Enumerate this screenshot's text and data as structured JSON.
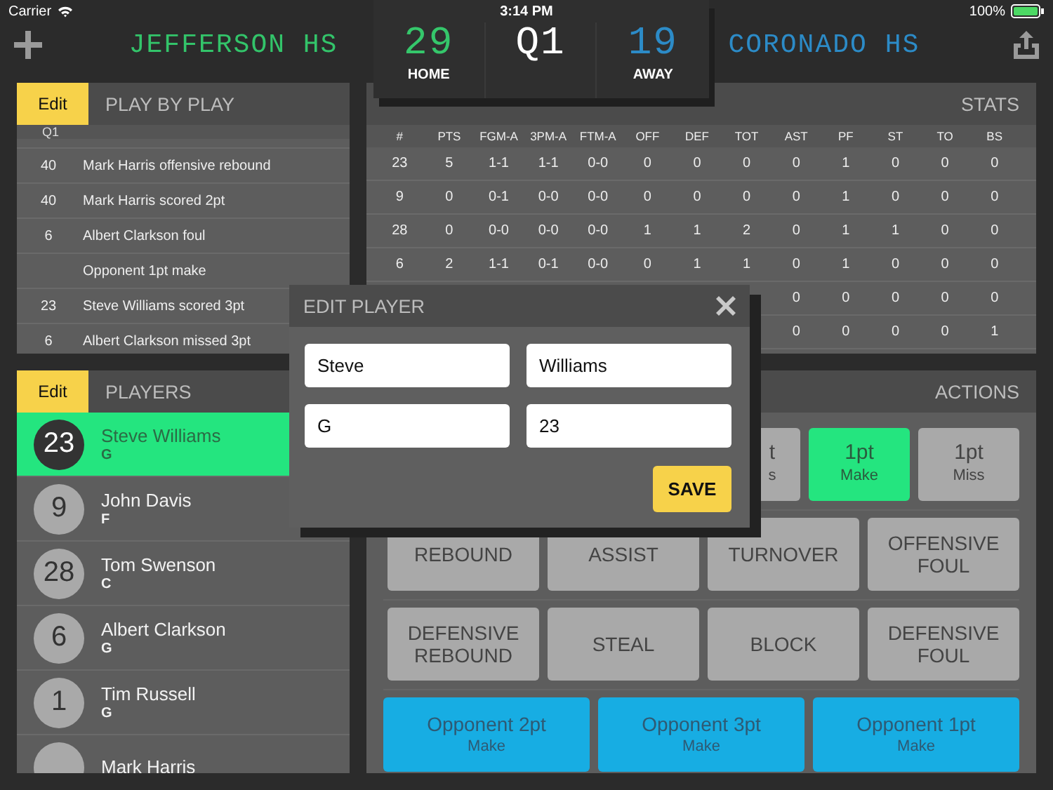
{
  "status_bar": {
    "carrier": "Carrier",
    "time": "3:14 PM",
    "battery": "100%"
  },
  "scoreboard": {
    "home_team": "JEFFERSON HS",
    "home_score": "29",
    "home_label": "HOME",
    "period": "Q1",
    "away_score": "19",
    "away_label": "AWAY",
    "away_team": "CORONADO HS"
  },
  "play_by_play": {
    "edit": "Edit",
    "title": "PLAY BY PLAY",
    "period": "Q1",
    "plays": [
      {
        "number": "40",
        "text": "Mark Harris offensive rebound"
      },
      {
        "number": "40",
        "text": "Mark Harris scored 2pt"
      },
      {
        "number": "6",
        "text": "Albert Clarkson foul"
      },
      {
        "text": "Opponent 1pt make"
      },
      {
        "number": "23",
        "text": "Steve Williams scored 3pt"
      },
      {
        "number": "6",
        "text": "Albert Clarkson missed 3pt"
      }
    ]
  },
  "stats": {
    "title": "STATS",
    "columns": [
      "#",
      "PTS",
      "FGM-A",
      "3PM-A",
      "FTM-A",
      "OFF",
      "DEF",
      "TOT",
      "AST",
      "PF",
      "ST",
      "TO",
      "BS"
    ],
    "rows": [
      [
        "23",
        "5",
        "1-1",
        "1-1",
        "0-0",
        "0",
        "0",
        "0",
        "0",
        "1",
        "0",
        "0",
        "0"
      ],
      [
        "9",
        "0",
        "0-1",
        "0-0",
        "0-0",
        "0",
        "0",
        "0",
        "0",
        "1",
        "0",
        "0",
        "0"
      ],
      [
        "28",
        "0",
        "0-0",
        "0-0",
        "0-0",
        "1",
        "1",
        "2",
        "0",
        "1",
        "1",
        "0",
        "0"
      ],
      [
        "6",
        "2",
        "1-1",
        "0-1",
        "0-0",
        "0",
        "1",
        "1",
        "0",
        "1",
        "0",
        "0",
        "0"
      ],
      [
        "0",
        "0",
        "0",
        "0",
        "0"
      ],
      [
        "0",
        "0",
        "0",
        "0",
        "1"
      ]
    ]
  },
  "players": {
    "edit": "Edit",
    "title": "PLAYERS",
    "items": [
      {
        "number": "23",
        "name": "Steve Williams",
        "position": "G",
        "selected": true
      },
      {
        "number": "9",
        "name": "John Davis",
        "position": "F",
        "selected": false
      },
      {
        "number": "28",
        "name": "Tom Swenson",
        "position": "C",
        "selected": false
      },
      {
        "number": "6",
        "name": "Albert Clarkson",
        "position": "G",
        "selected": false
      },
      {
        "number": "1",
        "name": "Tim Russell",
        "position": "G",
        "selected": false
      },
      {
        "name": "Mark Harris",
        "selected": false
      }
    ]
  },
  "actions": {
    "title": "ACTIONS",
    "shot_buttons": [
      {
        "kind": "covered",
        "label": "t",
        "sub": "s",
        "selected": false
      },
      {
        "kind": "small",
        "label": "1pt",
        "sub": "Make",
        "selected": true
      },
      {
        "kind": "small",
        "label": "1pt",
        "sub": "Miss",
        "selected": false
      }
    ],
    "rows": [
      [
        {
          "kind": "wide",
          "label": "REBOUND",
          "selected": false
        },
        {
          "kind": "wide",
          "label": "ASSIST",
          "selected": false
        },
        {
          "kind": "wide",
          "label": "TURNOVER",
          "selected": false
        },
        {
          "kind": "wide",
          "label": "OFFENSIVE FOUL",
          "selected": false
        }
      ],
      [
        {
          "kind": "wide",
          "label": "DEFENSIVE REBOUND",
          "selected": false
        },
        {
          "kind": "wide",
          "label": "STEAL",
          "selected": false
        },
        {
          "kind": "wide",
          "label": "BLOCK",
          "selected": false
        },
        {
          "kind": "wide",
          "label": "DEFENSIVE FOUL",
          "selected": false
        }
      ]
    ],
    "opponent_buttons": [
      {
        "kind": "opponent",
        "label": "Opponent 2pt",
        "sub": "Make",
        "selected": false
      },
      {
        "kind": "opponent",
        "label": "Opponent 3pt",
        "sub": "Make",
        "selected": false
      },
      {
        "kind": "opponent",
        "label": "Opponent 1pt",
        "sub": "Make",
        "selected": false
      }
    ]
  },
  "edit_player": {
    "title": "EDIT PLAYER",
    "fields": [
      {
        "value": "Steve"
      },
      {
        "value": "Williams"
      },
      {
        "value": "G"
      },
      {
        "value": "23"
      }
    ],
    "save": "SAVE"
  }
}
